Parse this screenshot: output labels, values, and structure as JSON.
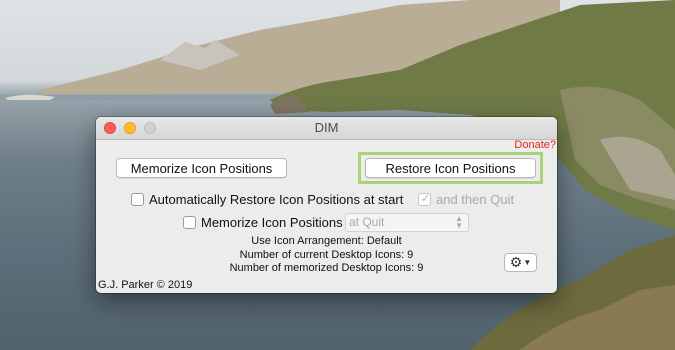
{
  "window": {
    "title": "DIM",
    "donate_label": "Donate?"
  },
  "buttons": {
    "memorize_label": "Memorize Icon Positions",
    "restore_label": "Restore Icon Positions"
  },
  "options": {
    "auto_restore_label": "Automatically Restore Icon Positions at start",
    "auto_restore_checked": false,
    "then_quit_label": "and then Quit",
    "then_quit_checked": true,
    "then_quit_enabled": false,
    "memorize_label": "Memorize Icon Positions",
    "memorize_checked": false,
    "memorize_when_selected": "at Quit",
    "memorize_when_enabled": false
  },
  "info": {
    "arrangement": "Use Icon Arrangement: Default",
    "current_icons": "Number of current Desktop Icons: 9",
    "memorized_icons": "Number of memorized Desktop Icons: 9"
  },
  "footer": {
    "copyright": "G.J. Parker © 2019"
  },
  "icons": {
    "gear": "gear-icon",
    "dropdown": "chevron-down-icon",
    "checkmark": "checkmark-icon",
    "select_arrows": "up-down-arrows-icon"
  },
  "colors": {
    "donate": "#e0241c",
    "highlight": "#a9d27a",
    "close": "#fc5f57",
    "minimize": "#fdbc2e",
    "zoom": "#d0d0d0"
  }
}
